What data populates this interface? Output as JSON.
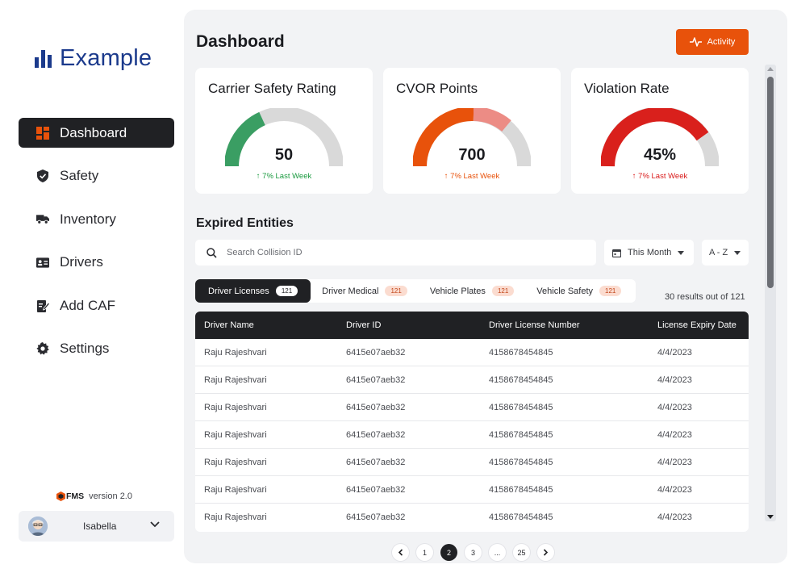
{
  "sidebar": {
    "brand": "Example",
    "nav": [
      {
        "label": "Dashboard",
        "icon": "dashboard-icon",
        "active": true
      },
      {
        "label": "Safety",
        "icon": "shield-icon"
      },
      {
        "label": "Inventory",
        "icon": "truck-icon"
      },
      {
        "label": "Drivers",
        "icon": "id-card-icon"
      },
      {
        "label": "Add CAF",
        "icon": "edit-document-icon"
      },
      {
        "label": "Settings",
        "icon": "gear-icon"
      }
    ],
    "product": "FMS",
    "version": "version 2.0",
    "user": {
      "name": "Isabella"
    }
  },
  "header": {
    "title": "Dashboard",
    "activity_label": "Activity"
  },
  "cards": [
    {
      "title": "Carrier Safety Rating",
      "value": "50",
      "trend": "7% Last Week",
      "level": 0.5,
      "trend_color": "#1a9a3f"
    },
    {
      "title": "CVOR Points",
      "value": "700",
      "trend": "7% Last Week",
      "level": 0.7,
      "trend_color": "#e8520b"
    },
    {
      "title": "Violation Rate",
      "value": "45%",
      "trend": "7% Last Week",
      "level": 0.8,
      "trend_color": "#d91a1a"
    }
  ],
  "expired": {
    "title": "Expired Entities",
    "search_placeholder": "Search Collision ID",
    "period": "This Month",
    "sort": "A - Z",
    "tabs": [
      {
        "label": "Driver Licenses",
        "count": "121",
        "active": true
      },
      {
        "label": "Driver Medical",
        "count": "121"
      },
      {
        "label": "Vehicle Plates",
        "count": "121"
      },
      {
        "label": "Vehicle Safety",
        "count": "121"
      }
    ],
    "results": "30 results out of 121",
    "columns": [
      "Driver Name",
      "Driver ID",
      "Driver License Number",
      "License Expiry Date"
    ],
    "rows": [
      [
        "Raju Rajeshvari",
        "6415e07aeb32",
        "4158678454845",
        "4/4/2023"
      ],
      [
        "Raju Rajeshvari",
        "6415e07aeb32",
        "4158678454845",
        "4/4/2023"
      ],
      [
        "Raju Rajeshvari",
        "6415e07aeb32",
        "4158678454845",
        "4/4/2023"
      ],
      [
        "Raju Rajeshvari",
        "6415e07aeb32",
        "4158678454845",
        "4/4/2023"
      ],
      [
        "Raju Rajeshvari",
        "6415e07aeb32",
        "4158678454845",
        "4/4/2023"
      ],
      [
        "Raju Rajeshvari",
        "6415e07aeb32",
        "4158678454845",
        "4/4/2023"
      ],
      [
        "Raju Rajeshvari",
        "6415e07aeb32",
        "4158678454845",
        "4/4/2023"
      ]
    ]
  },
  "pagination": {
    "prev_icon": "chevron-left-icon",
    "next_icon": "chevron-right-icon",
    "pages": [
      "1",
      "2",
      "3",
      "...",
      "25"
    ],
    "current": "2"
  },
  "colors": {
    "brand": "#1b3a8c",
    "accent": "#e8520b",
    "green": "#3a9e63",
    "orange": "#e8520b",
    "salmon": "#ec8c85",
    "red": "#d9201c",
    "track": "#d9d9d9",
    "dark": "#202124"
  }
}
